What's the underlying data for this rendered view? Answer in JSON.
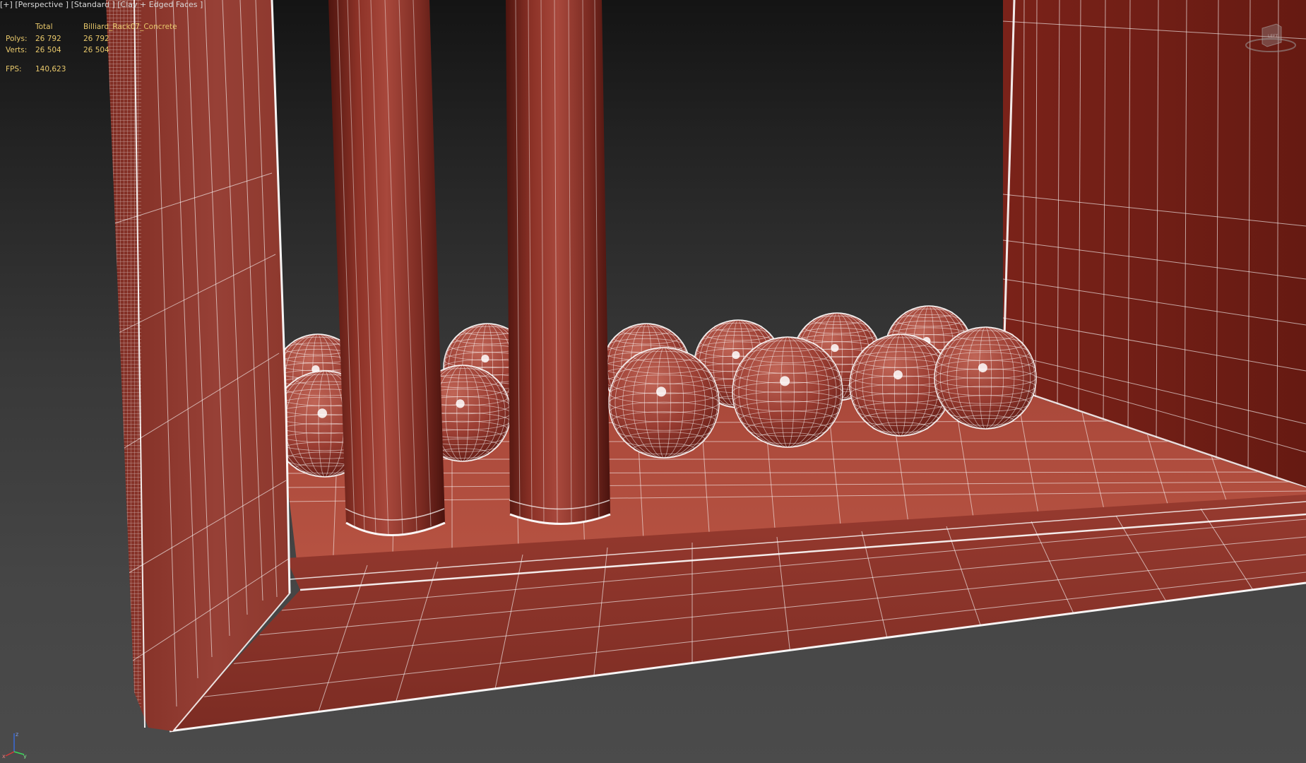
{
  "viewport": {
    "label": {
      "plus": "[+]",
      "view": "[Perspective ]",
      "shading_preset": "[Standard ]",
      "shading_mode": "[Clay + Edged Faces ]"
    },
    "stats": {
      "header": {
        "total": "Total",
        "selection": "Billiard_Rack07_Concrete"
      },
      "polys": {
        "label": "Polys:",
        "total": "26 792",
        "selection": "26 792"
      },
      "verts": {
        "label": "Verts:",
        "total": "26 504",
        "selection": "26 504"
      },
      "fps": {
        "label": "FPS:",
        "value": "140,623"
      }
    },
    "viewcube": {
      "face_label": "LEFT"
    },
    "axis_tripod": {
      "x": "x",
      "y": "y",
      "z": "z"
    }
  },
  "colors": {
    "clay": "#a24a3e",
    "clay_dark": "#6e1f18",
    "wire": "#ffffff",
    "stats_text": "#e8c86b",
    "label_text": "#d8d8d8",
    "bg_top": "#141414",
    "bg_bottom": "#4b4b4b"
  }
}
